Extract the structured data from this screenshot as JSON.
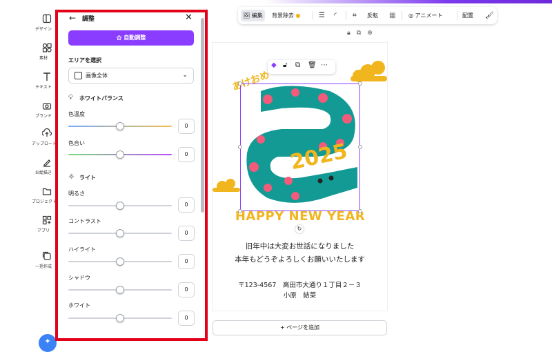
{
  "rail": [
    {
      "label": "デザイン",
      "icon": "layout-icon"
    },
    {
      "label": "素材",
      "icon": "elements-icon"
    },
    {
      "label": "テキスト",
      "icon": "text-icon"
    },
    {
      "label": "ブランド",
      "icon": "brand-icon"
    },
    {
      "label": "アップロード",
      "icon": "upload-icon"
    },
    {
      "label": "お絵描き",
      "icon": "draw-icon"
    },
    {
      "label": "プロジェクト",
      "icon": "folder-icon"
    },
    {
      "label": "アプリ",
      "icon": "apps-icon"
    },
    {
      "label": "一括作成",
      "icon": "bulk-create-icon"
    }
  ],
  "panel": {
    "title": "調整",
    "auto_button": "自動調整",
    "area_label": "エリアを選択",
    "area_value": "画像全体",
    "white_balance": "ホワイトバランス",
    "color_temp": {
      "label": "色温度",
      "value": "0",
      "level": 0.5
    },
    "tint": {
      "label": "色合い",
      "value": "0",
      "level": 0.5
    },
    "light": "ライト",
    "brightness": {
      "label": "明るさ",
      "value": "0",
      "level": 0.5
    },
    "contrast": {
      "label": "コントラスト",
      "value": "0",
      "level": 0.5
    },
    "highlight": {
      "label": "ハイライト",
      "value": "0",
      "level": 0.5
    },
    "shadow": {
      "label": "シャドウ",
      "value": "0",
      "level": 0.5
    },
    "white": {
      "label": "ホワイト",
      "value": "0",
      "level": 0.5
    }
  },
  "toolbar": {
    "edit": "編集",
    "bg_remove": "背景除去",
    "flip": "反転",
    "animate": "アニメート",
    "arrange": "配置"
  },
  "card": {
    "handwritten": "あけおめ",
    "year": "2025",
    "happy_new_year": "HAPPY NEW YEAR",
    "greeting_line1": "旧年中は大変お世話になりました",
    "greeting_line2": "本年もどうぞよろしくお願いいたします",
    "address": "〒123-4567　高田市大通り１丁目２－３",
    "name": "小原　結菜"
  },
  "add_page": "+ ページを追加",
  "colors": {
    "accent": "#8b3dff",
    "frame": "#e3001b",
    "snake": "#139a94",
    "dots": "#f25b7a",
    "gold": "#f1b51e"
  }
}
